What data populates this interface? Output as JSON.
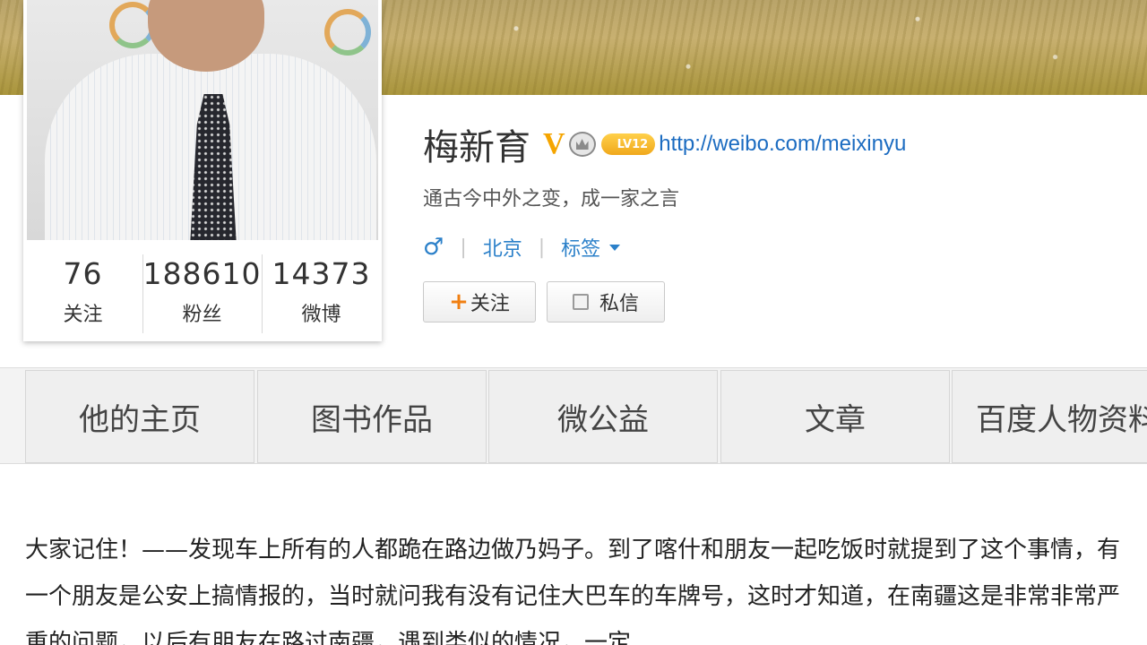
{
  "profile": {
    "name": "梅新育",
    "verified_badge": "V",
    "level_badge": "LV12",
    "url": "http://weibo.com/meixinyu",
    "bio": "通古今中外之变，成一家之言",
    "gender_symbol": "♂",
    "separator": "|",
    "location": "北京",
    "tags_label": "标签"
  },
  "stats": [
    {
      "value": "76",
      "label": "关注"
    },
    {
      "value": "188610",
      "label": "粉丝"
    },
    {
      "value": "14373",
      "label": "微博"
    }
  ],
  "actions": {
    "follow_plus": "+",
    "follow_label": "关注",
    "message_label": "私信"
  },
  "tabs": [
    {
      "label": "他的主页"
    },
    {
      "label": "图书作品"
    },
    {
      "label": "微公益"
    },
    {
      "label": "文章"
    },
    {
      "label": "百度人物资料"
    }
  ],
  "post": {
    "text": "大家记住！——发现车上所有的人都跪在路边做乃妈子。到了喀什和朋友一起吃饭时就提到了这个事情，有一个朋友是公安上搞情报的，当时就问我有没有记住大巴车的车牌号，这时才知道，在南疆这是非常非常严重的问题，以后有朋友在路过南疆，遇到类似的情况，一定"
  },
  "colors": {
    "link": "#1c6cc1",
    "accent_orange": "#f07f12",
    "verified_gold": "#f5a500"
  },
  "icons": [
    "crown-icon",
    "male-icon",
    "caret-down-icon",
    "plus-icon",
    "message-icon"
  ]
}
